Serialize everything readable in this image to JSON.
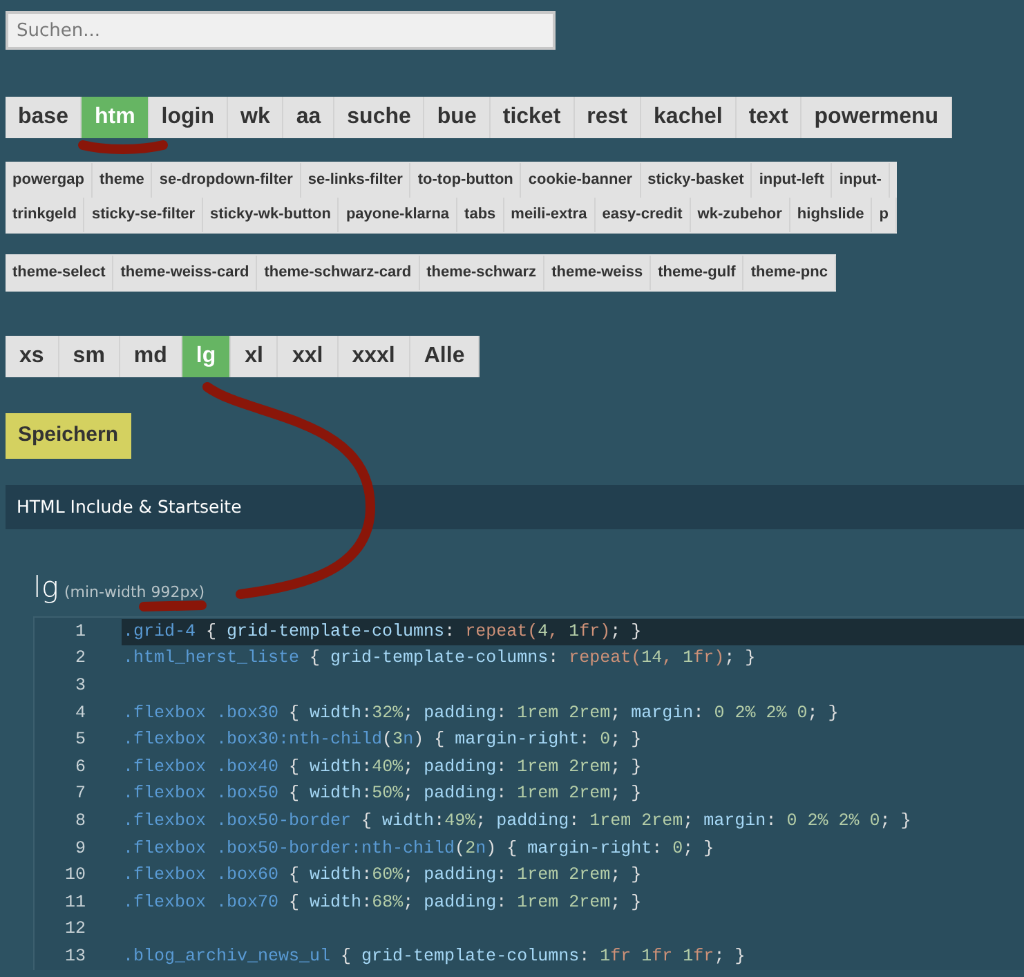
{
  "search": {
    "placeholder": "Suchen..."
  },
  "main_tabs": [
    {
      "label": "base",
      "selected": false
    },
    {
      "label": "htm",
      "selected": true
    },
    {
      "label": "login",
      "selected": false
    },
    {
      "label": "wk",
      "selected": false
    },
    {
      "label": "aa",
      "selected": false
    },
    {
      "label": "suche",
      "selected": false
    },
    {
      "label": "bue",
      "selected": false
    },
    {
      "label": "ticket",
      "selected": false
    },
    {
      "label": "rest",
      "selected": false
    },
    {
      "label": "kachel",
      "selected": false
    },
    {
      "label": "text",
      "selected": false
    },
    {
      "label": "powermenu",
      "selected": false
    }
  ],
  "module_tags": {
    "rows": [
      {
        "items": [
          "powergap",
          "theme",
          "se-dropdown-filter",
          "se-links-filter",
          "to-top-button",
          "cookie-banner",
          "sticky-basket",
          "input-left",
          "input-"
        ]
      },
      {
        "items": [
          "trinkgeld",
          "sticky-se-filter",
          "sticky-wk-button",
          "payone-klarna",
          "tabs",
          "meili-extra",
          "easy-credit",
          "wk-zubehor",
          "highslide",
          "p"
        ]
      }
    ]
  },
  "theme_tags": {
    "items": [
      "theme-select",
      "theme-weiss-card",
      "theme-schwarz-card",
      "theme-schwarz",
      "theme-weiss",
      "theme-gulf",
      "theme-pnc"
    ]
  },
  "breakpoint_tabs": [
    {
      "label": "xs",
      "selected": false
    },
    {
      "label": "sm",
      "selected": false
    },
    {
      "label": "md",
      "selected": false
    },
    {
      "label": "lg",
      "selected": true
    },
    {
      "label": "xl",
      "selected": false
    },
    {
      "label": "xxl",
      "selected": false
    },
    {
      "label": "xxxl",
      "selected": false
    },
    {
      "label": "Alle",
      "selected": false
    }
  ],
  "save_button": "Speichern",
  "section_header": "HTML Include & Startseite",
  "breakpoint_heading": {
    "name": "lg",
    "note": "(min-width 992px)"
  },
  "editor": {
    "lines": [
      {
        "number": "1",
        "selected": true,
        "tokens": [
          {
            "kind": "sel",
            "text": ".grid-4"
          },
          {
            "kind": "punc",
            "text": " { "
          },
          {
            "kind": "prop",
            "text": "grid-template-columns"
          },
          {
            "kind": "punc",
            "text": ": "
          },
          {
            "kind": "func",
            "text": "repeat("
          },
          {
            "kind": "num",
            "text": "4"
          },
          {
            "kind": "func",
            "text": ", "
          },
          {
            "kind": "num",
            "text": "1"
          },
          {
            "kind": "func",
            "text": "fr)"
          },
          {
            "kind": "punc",
            "text": "; }"
          }
        ]
      },
      {
        "number": "2",
        "selected": false,
        "tokens": [
          {
            "kind": "sel",
            "text": ".html_herst_liste"
          },
          {
            "kind": "punc",
            "text": " { "
          },
          {
            "kind": "prop",
            "text": "grid-template-columns"
          },
          {
            "kind": "punc",
            "text": ": "
          },
          {
            "kind": "func",
            "text": "repeat("
          },
          {
            "kind": "num",
            "text": "14"
          },
          {
            "kind": "func",
            "text": ", "
          },
          {
            "kind": "num",
            "text": "1"
          },
          {
            "kind": "func",
            "text": "fr)"
          },
          {
            "kind": "punc",
            "text": "; }"
          }
        ]
      },
      {
        "number": "3",
        "selected": false
      },
      {
        "number": "4",
        "selected": false,
        "tokens": [
          {
            "kind": "sel",
            "text": ".flexbox .box30"
          },
          {
            "kind": "punc",
            "text": " { "
          },
          {
            "kind": "prop",
            "text": "width"
          },
          {
            "kind": "punc",
            "text": ":"
          },
          {
            "kind": "num",
            "text": "32%"
          },
          {
            "kind": "punc",
            "text": "; "
          },
          {
            "kind": "prop",
            "text": "padding"
          },
          {
            "kind": "punc",
            "text": ": "
          },
          {
            "kind": "num",
            "text": "1rem 2rem"
          },
          {
            "kind": "punc",
            "text": "; "
          },
          {
            "kind": "prop",
            "text": "margin"
          },
          {
            "kind": "punc",
            "text": ": "
          },
          {
            "kind": "num",
            "text": "0 2% 2% 0"
          },
          {
            "kind": "punc",
            "text": "; }"
          }
        ]
      },
      {
        "number": "5",
        "selected": false,
        "tokens": [
          {
            "kind": "sel",
            "text": ".flexbox .box30:nth-child"
          },
          {
            "kind": "punc",
            "text": "("
          },
          {
            "kind": "num",
            "text": "3"
          },
          {
            "kind": "sel",
            "text": "n"
          },
          {
            "kind": "punc",
            "text": ") { "
          },
          {
            "kind": "prop",
            "text": "margin-right"
          },
          {
            "kind": "punc",
            "text": ": "
          },
          {
            "kind": "num",
            "text": "0"
          },
          {
            "kind": "punc",
            "text": "; }"
          }
        ]
      },
      {
        "number": "6",
        "selected": false,
        "tokens": [
          {
            "kind": "sel",
            "text": ".flexbox .box40"
          },
          {
            "kind": "punc",
            "text": " { "
          },
          {
            "kind": "prop",
            "text": "width"
          },
          {
            "kind": "punc",
            "text": ":"
          },
          {
            "kind": "num",
            "text": "40%"
          },
          {
            "kind": "punc",
            "text": "; "
          },
          {
            "kind": "prop",
            "text": "padding"
          },
          {
            "kind": "punc",
            "text": ": "
          },
          {
            "kind": "num",
            "text": "1rem 2rem"
          },
          {
            "kind": "punc",
            "text": "; }"
          }
        ]
      },
      {
        "number": "7",
        "selected": false,
        "tokens": [
          {
            "kind": "sel",
            "text": ".flexbox .box50"
          },
          {
            "kind": "punc",
            "text": " { "
          },
          {
            "kind": "prop",
            "text": "width"
          },
          {
            "kind": "punc",
            "text": ":"
          },
          {
            "kind": "num",
            "text": "50%"
          },
          {
            "kind": "punc",
            "text": "; "
          },
          {
            "kind": "prop",
            "text": "padding"
          },
          {
            "kind": "punc",
            "text": ": "
          },
          {
            "kind": "num",
            "text": "1rem 2rem"
          },
          {
            "kind": "punc",
            "text": "; }"
          }
        ]
      },
      {
        "number": "8",
        "selected": false,
        "tokens": [
          {
            "kind": "sel",
            "text": ".flexbox .box50-border"
          },
          {
            "kind": "punc",
            "text": " { "
          },
          {
            "kind": "prop",
            "text": "width"
          },
          {
            "kind": "punc",
            "text": ":"
          },
          {
            "kind": "num",
            "text": "49%"
          },
          {
            "kind": "punc",
            "text": "; "
          },
          {
            "kind": "prop",
            "text": "padding"
          },
          {
            "kind": "punc",
            "text": ": "
          },
          {
            "kind": "num",
            "text": "1rem 2rem"
          },
          {
            "kind": "punc",
            "text": "; "
          },
          {
            "kind": "prop",
            "text": "margin"
          },
          {
            "kind": "punc",
            "text": ": "
          },
          {
            "kind": "num",
            "text": "0 2% 2% 0"
          },
          {
            "kind": "punc",
            "text": "; }"
          }
        ]
      },
      {
        "number": "9",
        "selected": false,
        "tokens": [
          {
            "kind": "sel",
            "text": ".flexbox .box50-border:nth-child"
          },
          {
            "kind": "punc",
            "text": "("
          },
          {
            "kind": "num",
            "text": "2"
          },
          {
            "kind": "sel",
            "text": "n"
          },
          {
            "kind": "punc",
            "text": ") { "
          },
          {
            "kind": "prop",
            "text": "margin-right"
          },
          {
            "kind": "punc",
            "text": ": "
          },
          {
            "kind": "num",
            "text": "0"
          },
          {
            "kind": "punc",
            "text": "; }"
          }
        ]
      },
      {
        "number": "10",
        "selected": false,
        "tokens": [
          {
            "kind": "sel",
            "text": ".flexbox .box60"
          },
          {
            "kind": "punc",
            "text": " { "
          },
          {
            "kind": "prop",
            "text": "width"
          },
          {
            "kind": "punc",
            "text": ":"
          },
          {
            "kind": "num",
            "text": "60%"
          },
          {
            "kind": "punc",
            "text": "; "
          },
          {
            "kind": "prop",
            "text": "padding"
          },
          {
            "kind": "punc",
            "text": ": "
          },
          {
            "kind": "num",
            "text": "1rem 2rem"
          },
          {
            "kind": "punc",
            "text": "; }"
          }
        ]
      },
      {
        "number": "11",
        "selected": false,
        "tokens": [
          {
            "kind": "sel",
            "text": ".flexbox .box70"
          },
          {
            "kind": "punc",
            "text": " { "
          },
          {
            "kind": "prop",
            "text": "width"
          },
          {
            "kind": "punc",
            "text": ":"
          },
          {
            "kind": "num",
            "text": "68%"
          },
          {
            "kind": "punc",
            "text": "; "
          },
          {
            "kind": "prop",
            "text": "padding"
          },
          {
            "kind": "punc",
            "text": ": "
          },
          {
            "kind": "num",
            "text": "1rem 2rem"
          },
          {
            "kind": "punc",
            "text": "; }"
          }
        ]
      },
      {
        "number": "12",
        "selected": false
      },
      {
        "number": "13",
        "selected": false,
        "tokens": [
          {
            "kind": "sel",
            "text": ".blog_archiv_news_ul"
          },
          {
            "kind": "punc",
            "text": " { "
          },
          {
            "kind": "prop",
            "text": "grid-template-columns"
          },
          {
            "kind": "punc",
            "text": ": "
          },
          {
            "kind": "num",
            "text": "1"
          },
          {
            "kind": "func",
            "text": "fr "
          },
          {
            "kind": "num",
            "text": "1"
          },
          {
            "kind": "func",
            "text": "fr "
          },
          {
            "kind": "num",
            "text": "1"
          },
          {
            "kind": "func",
            "text": "fr"
          },
          {
            "kind": "punc",
            "text": "; }"
          }
        ]
      }
    ]
  }
}
